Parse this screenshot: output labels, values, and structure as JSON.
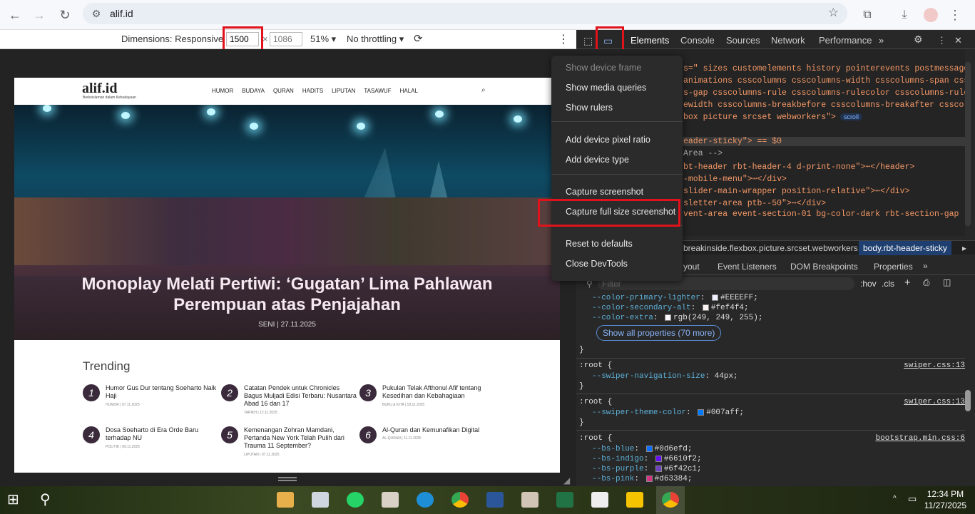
{
  "browser": {
    "url": "alif.id",
    "back": "←",
    "forward": "→",
    "reload": "↻"
  },
  "device_toolbar": {
    "dimensions_label": "Dimensions: Responsive",
    "width_value": "1500",
    "times": "×",
    "height_placeholder": "1086",
    "zoom": "51%",
    "throttling": "No throttling"
  },
  "site": {
    "logo": "alif.id",
    "tagline": "Berkeislaman dalam Kebudayaan",
    "nav": [
      "HUMOR",
      "BUDAYA",
      "QURAN",
      "HADITS",
      "LIPUTAN",
      "TASAWUF",
      "HALAL"
    ],
    "hero_title": "Monoplay Melati Pertiwi: ‘Gugatan’ Lima Pahlawan Perempuan atas Penjajahan",
    "hero_meta": "SENI | 27.11.2025",
    "trending_heading": "Trending",
    "trending": [
      {
        "num": "1",
        "title": "Humor Gus Dur tentang Soeharto Naik Haji",
        "meta": "HUMOR | 07.11.2025"
      },
      {
        "num": "2",
        "title": "Catatan Pendek untuk Chronicles Bagus Muljadi Edisi Terbaru: Nusantara Abad 16 dan 17",
        "meta": "TARIKH | 12.11.2025"
      },
      {
        "num": "3",
        "title": "Pukulan Telak Afthonul Afif tentang Kesedihan dan Kebahagiaan",
        "meta": "BUKU & KITA | 18.11.2025"
      },
      {
        "num": "4",
        "title": "Dosa Soeharto di Era Orde Baru terhadap NU",
        "meta": "POLITIK | 09.11.2025"
      },
      {
        "num": "5",
        "title": "Kemenangan Zohran Mamdani, Pertanda New York Telah Pulih dari Trauma 11 September?",
        "meta": "LIPUTAN | 07.11.2025"
      },
      {
        "num": "6",
        "title": "Al-Quran dan Kemunafikan Digital",
        "meta": "AL-QURAN | 11.11.2025"
      }
    ]
  },
  "devtools": {
    "tabs": [
      "Elements",
      "Console",
      "Sources",
      "Network",
      "Performance"
    ],
    "more": "»",
    "code_lines": [
      "s=\" sizes customelements history pointerevents postmessage",
      "animations csscolumns csscolumns-width csscolumns-span cssc",
      "s-gap csscolumns-rule csscolumns-rulecolor csscolumns-rule",
      "ewidth csscolumns-breakbefore csscolumns-breakafter csscolu",
      "box picture srcset webworkers\">",
      "",
      "eader-sticky\"> == $0",
      " Area -->",
      "bt-header rbt-header-4 d-print-none\">⋯</header>",
      "-mobile-menu\">⋯</div>",
      "slider-main-wrapper position-relative\">⋯</div>",
      "sletter-area  ptb--50\">⋯</div>",
      "vent-area event-section-01 bg-color-dark rbt-section-gap"
    ],
    "scroll_badge": "scroll",
    "breadcrumb_left": "breakinside.flexbox.picture.srcset.webworkers",
    "breadcrumb_right": "body.rbt-header-sticky",
    "style_tabs": [
      "yout",
      "Event Listeners",
      "DOM Breakpoints",
      "Properties"
    ],
    "filter_placeholder": "Filter",
    "hov": ":hov",
    "cls": ".cls",
    "styles": {
      "vars_top": [
        {
          "name": "--color-primary-lighter",
          "value": "#EEEEFF",
          "color": "#EEEEFF"
        },
        {
          "name": "--color-secondary-alt",
          "value": "#fef4f4",
          "color": "#fef4f4"
        },
        {
          "name": "--color-extra",
          "value": "rgb(249, 249, 255)",
          "color": "#f9f9ff"
        }
      ],
      "show_all": "Show all properties (70 more)",
      "rules": [
        {
          "selector": ":root {",
          "file": "swiper.css:13",
          "prop": "--swiper-navigation-size",
          "value": "44px"
        },
        {
          "selector": ":root {",
          "file": "swiper.css:13",
          "prop": "--swiper-theme-color",
          "value": "#007aff",
          "color": "#007aff"
        }
      ],
      "bootstrap": {
        "selector": ":root {",
        "file": "bootstrap.min.css:6",
        "vars": [
          {
            "name": "--bs-blue",
            "value": "#0d6efd",
            "color": "#0d6efd"
          },
          {
            "name": "--bs-indigo",
            "value": "#6610f2",
            "color": "#6610f2"
          },
          {
            "name": "--bs-purple",
            "value": "#6f42c1",
            "color": "#6f42c1"
          },
          {
            "name": "--bs-pink",
            "value": "#d63384",
            "color": "#d63384"
          }
        ]
      }
    }
  },
  "context_menu": {
    "items": [
      "Show device frame",
      "Show media queries",
      "Show rulers",
      "Add device pixel ratio",
      "Add device type",
      "Capture screenshot",
      "Capture full size screenshot",
      "Reset to defaults",
      "Close DevTools"
    ]
  },
  "taskbar": {
    "time": "12:34 PM",
    "date": "11/27/2025"
  },
  "colors": {
    "highlight_red": "#e0121b",
    "devtools_bg": "#282828",
    "accent_blue": "#8ab4f8"
  }
}
